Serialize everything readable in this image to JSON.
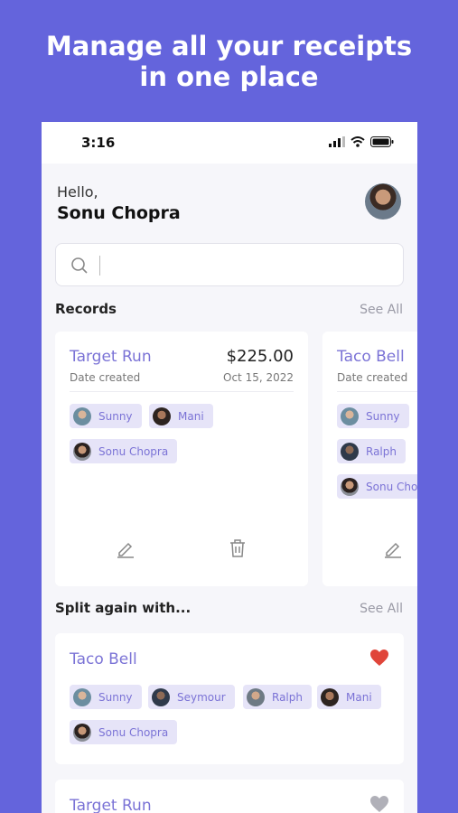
{
  "promo": {
    "line1": "Manage all your receipts",
    "line2": "in one place"
  },
  "status": {
    "time": "3:16",
    "icons": [
      "signal-icon",
      "wifi-icon",
      "battery-icon"
    ]
  },
  "header": {
    "greeting": "Hello,",
    "name": "Sonu Chopra"
  },
  "search": {
    "placeholder": "",
    "icon": "search-icon"
  },
  "records": {
    "title": "Records",
    "see_all": "See All",
    "cards": [
      {
        "title": "Target Run",
        "amount": "$225.00",
        "date_label": "Date created",
        "date": "Oct 15, 2022",
        "members": [
          "Sunny",
          "Mani",
          "Sonu Chopra"
        ]
      },
      {
        "title": "Taco Bell",
        "date_label": "Date created",
        "members": [
          "Sunny",
          "Ralph",
          "Sonu Cho"
        ]
      }
    ]
  },
  "split": {
    "title": "Split again with...",
    "see_all": "See All",
    "cards": [
      {
        "title": "Taco Bell",
        "favorite": true,
        "members": [
          "Sunny",
          "Seymour",
          "Ralph",
          "Mani",
          "Sonu Chopra"
        ]
      },
      {
        "title": "Target Run",
        "favorite": false
      }
    ]
  },
  "colors": {
    "brand": "#6464dc",
    "accent": "#7b73d6",
    "chip_bg": "#e6e4f8",
    "heart_active": "#e0453a",
    "heart_inactive": "#b0b0b8"
  }
}
